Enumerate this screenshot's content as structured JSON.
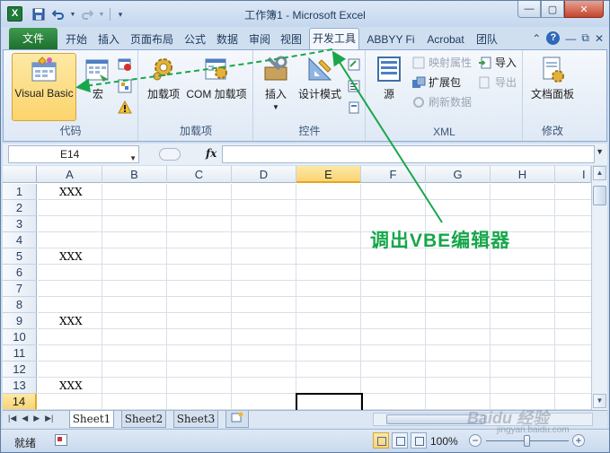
{
  "window": {
    "title": "工作簿1 - Microsoft Excel",
    "app_icon_letter": "X"
  },
  "quick_access": {
    "save_icon": "save-icon",
    "undo_icon": "undo-icon",
    "redo_icon": "redo-icon",
    "customize_icon": "chevron-down-icon"
  },
  "tabs": {
    "file": "文件",
    "items": [
      "开始",
      "插入",
      "页面布局",
      "公式",
      "数据",
      "审阅",
      "视图",
      "开发工具",
      "ABBYY Fi",
      "Acrobat",
      "团队"
    ],
    "active": "开发工具"
  },
  "ribbon": {
    "code": {
      "label": "代码",
      "visual_basic": "Visual Basic",
      "macros": "宏"
    },
    "addins": {
      "label": "加载项",
      "addins_btn": "加载项",
      "com_addins": "COM 加载项"
    },
    "controls": {
      "label": "控件",
      "insert": "插入",
      "design_mode": "设计模式"
    },
    "xml": {
      "label": "XML",
      "source": "源",
      "map_properties": "映射属性",
      "expansion_packs": "扩展包",
      "refresh_data": "刷新数据",
      "import": "导入",
      "export": "导出"
    },
    "modify": {
      "label": "修改",
      "document_panel": "文档面板"
    }
  },
  "formula_bar": {
    "name_box": "E14",
    "fx": "fx",
    "formula": ""
  },
  "sheet": {
    "columns": [
      "A",
      "B",
      "C",
      "D",
      "E",
      "F",
      "G",
      "H",
      "I"
    ],
    "rows": [
      "1",
      "2",
      "3",
      "4",
      "5",
      "6",
      "7",
      "8",
      "9",
      "10",
      "11",
      "12",
      "13",
      "14"
    ],
    "selected_column": "E",
    "selected_row": "14",
    "cells": [
      {
        "ref": "A1",
        "value": "XXX"
      },
      {
        "ref": "A5",
        "value": "XXX"
      },
      {
        "ref": "A9",
        "value": "XXX"
      },
      {
        "ref": "A13",
        "value": "XXX"
      }
    ]
  },
  "sheet_tabs": [
    "Sheet1",
    "Sheet2",
    "Sheet3"
  ],
  "status": {
    "ready": "就绪",
    "zoom": "100%"
  },
  "annotation": {
    "text": "调出VBE编辑器",
    "color": "#16a64a"
  },
  "watermark": {
    "text": "Baidu 经验",
    "sub": "jingyan.baidu.com"
  }
}
